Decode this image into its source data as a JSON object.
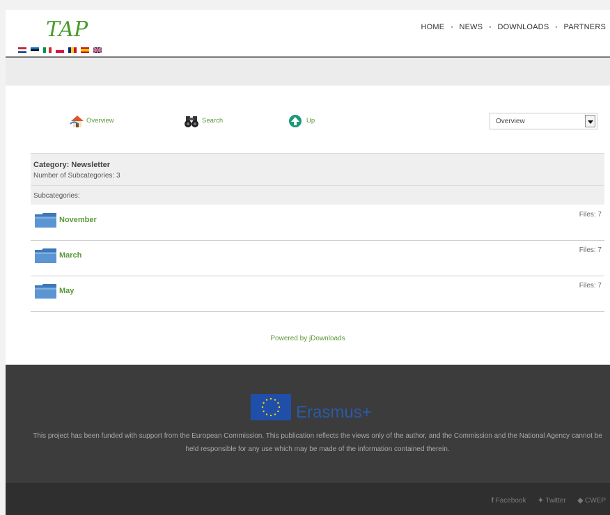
{
  "header": {
    "logo_text": "TAP",
    "nav": [
      "HOME",
      "NEWS",
      "DOWNLOADS",
      "PARTNERS"
    ],
    "flags": [
      "nl-flag-icon",
      "ee-flag-icon",
      "it-flag-icon",
      "pl-flag-icon",
      "ro-flag-icon",
      "es-flag-icon",
      "uk-flag-icon"
    ]
  },
  "toolbar": {
    "overview_label": "Overview",
    "search_label": "Search",
    "up_label": "Up",
    "jump_select_value": "Overview"
  },
  "category": {
    "title": "Category: Newsletter",
    "subcount": "Number of Subcategories: 3",
    "subcategories_label": "Subcategories:",
    "items": [
      {
        "name": "November",
        "files": "Files: 7"
      },
      {
        "name": "March",
        "files": "Files: 7"
      },
      {
        "name": "May",
        "files": "Files: 7"
      }
    ]
  },
  "powered": "Powered by jDownloads",
  "footer": {
    "program_name": "Erasmus+",
    "disclaimer": "This project has been funded with support from the European Commission. This publication reflects the views only of the author, and the Commission and the National Agency cannot be held responsible for any use which may be made of the information contained therein.",
    "social": [
      "Facebook",
      "Twitter",
      "CWEP"
    ]
  },
  "colors": {
    "accent": "#5a9a3a",
    "footer_bg": "#3c3c3c",
    "eu_blue": "#1f4fa8"
  }
}
